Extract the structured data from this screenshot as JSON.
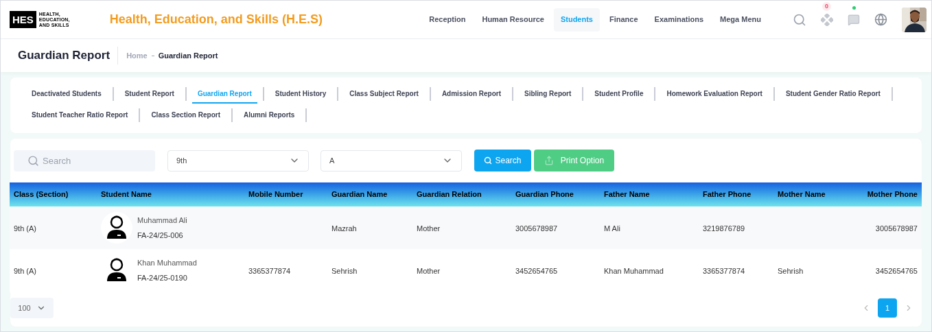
{
  "brand": {
    "logo_mark": "HES",
    "logo_text": "HEALTH, EDUCATION, AND SKILLS",
    "title": "Health, Education, and Skills (H.E.S)"
  },
  "nav": [
    {
      "label": "Reception",
      "selected": false
    },
    {
      "label": "Human Resource",
      "selected": false
    },
    {
      "label": "Students",
      "selected": true
    },
    {
      "label": "Finance",
      "selected": false
    },
    {
      "label": "Examinations",
      "selected": false
    },
    {
      "label": "Mega Menu",
      "selected": false
    }
  ],
  "header_icons": {
    "apps_badge": "0",
    "chat_online": true
  },
  "page": {
    "title": "Guardian Report",
    "breadcrumb": [
      "Home",
      "Guardian Report"
    ]
  },
  "report_tabs": [
    {
      "label": "Deactivated Students",
      "selected": false
    },
    {
      "label": "Student Report",
      "selected": false
    },
    {
      "label": "Guardian Report",
      "selected": true
    },
    {
      "label": "Student History",
      "selected": false
    },
    {
      "label": "Class Subject Report",
      "selected": false
    },
    {
      "label": "Admission Report",
      "selected": false
    },
    {
      "label": "Sibling Report",
      "selected": false
    },
    {
      "label": "Student Profile",
      "selected": false
    },
    {
      "label": "Homework Evaluation Report",
      "selected": false
    },
    {
      "label": "Student Gender Ratio Report",
      "selected": false
    },
    {
      "label": "Student Teacher Ratio Report",
      "selected": false
    },
    {
      "label": "Class Section Report",
      "selected": false
    },
    {
      "label": "Alumni Reports",
      "selected": false
    }
  ],
  "filters": {
    "search_placeholder": "Search",
    "class": "9th",
    "section": "A",
    "search_button": "Search",
    "print_button": "Print Option"
  },
  "table": {
    "columns": [
      "Class (Section)",
      "Student Name",
      "Mobile Number",
      "Guardian Name",
      "Guardian Relation",
      "Guardian Phone",
      "Father Name",
      "Father Phone",
      "Mother Name",
      "Mother Phone"
    ],
    "rows": [
      {
        "class_section": "9th (A)",
        "student_name": "Muhammad Ali",
        "student_id": "FA-24/25-006",
        "guardian_name": "Mazrah",
        "guardian_relation": "Mother",
        "guardian_phone": "3005678987",
        "father_name": "M Ali",
        "father_phone": "3219876789",
        "mother_phone": "3005678987"
      },
      {
        "class_section": "9th (A)",
        "student_name": "Khan Muhammad",
        "student_id": "FA-24/25-0190",
        "mobile_number": "3365377874",
        "guardian_name": "Sehrish",
        "guardian_relation": "Mother",
        "guardian_phone": "3452654765",
        "father_name": "Khan Muhammad",
        "father_phone": "3365377874",
        "mother_name": "Sehrish",
        "mother_phone": "3452654765"
      }
    ]
  },
  "pagination": {
    "page_size": "100",
    "pages": [
      {
        "label": "1",
        "selected": true
      }
    ]
  }
}
